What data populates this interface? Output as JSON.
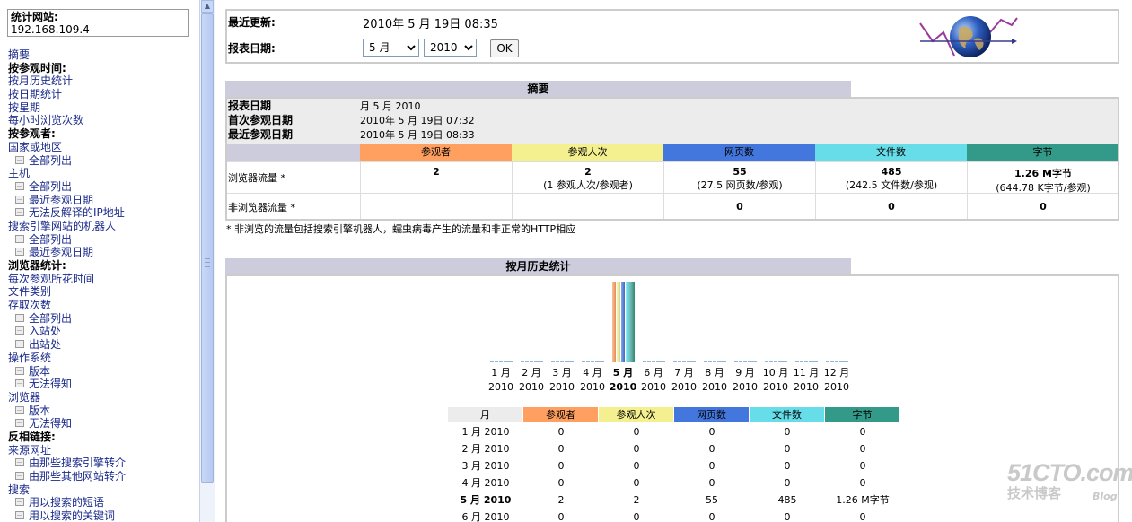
{
  "sidebar": {
    "site_label": "统计网站:",
    "site_value": "192.168.109.4",
    "items": [
      {
        "label": "摘要",
        "kind": "link"
      },
      {
        "label": "按参观时间:",
        "kind": "head"
      },
      {
        "label": "按月历史统计",
        "kind": "link"
      },
      {
        "label": "按日期统计",
        "kind": "link"
      },
      {
        "label": "按星期",
        "kind": "link"
      },
      {
        "label": "每小时浏览次数",
        "kind": "link"
      },
      {
        "label": "按参观者:",
        "kind": "head"
      },
      {
        "label": "国家或地区",
        "kind": "link"
      },
      {
        "label": "全部列出",
        "kind": "sub"
      },
      {
        "label": "主机",
        "kind": "link"
      },
      {
        "label": "全部列出",
        "kind": "sub"
      },
      {
        "label": "最近参观日期",
        "kind": "sub"
      },
      {
        "label": "无法反解译的IP地址",
        "kind": "sub"
      },
      {
        "label": "搜索引擎网站的机器人",
        "kind": "link"
      },
      {
        "label": "全部列出",
        "kind": "sub"
      },
      {
        "label": "最近参观日期",
        "kind": "sub"
      },
      {
        "label": "浏览器统计:",
        "kind": "head"
      },
      {
        "label": "每次参观所花时间",
        "kind": "link"
      },
      {
        "label": "文件类别",
        "kind": "link"
      },
      {
        "label": "存取次数",
        "kind": "link"
      },
      {
        "label": "全部列出",
        "kind": "sub"
      },
      {
        "label": "入站处",
        "kind": "sub"
      },
      {
        "label": "出站处",
        "kind": "sub"
      },
      {
        "label": "操作系统",
        "kind": "link"
      },
      {
        "label": "版本",
        "kind": "sub"
      },
      {
        "label": "无法得知",
        "kind": "sub"
      },
      {
        "label": "浏览器",
        "kind": "link"
      },
      {
        "label": "版本",
        "kind": "sub"
      },
      {
        "label": "无法得知",
        "kind": "sub"
      },
      {
        "label": "反相链接:",
        "kind": "head"
      },
      {
        "label": "来源网址",
        "kind": "link"
      },
      {
        "label": "由那些搜索引擎转介",
        "kind": "sub"
      },
      {
        "label": "由那些其他网站转介",
        "kind": "sub"
      },
      {
        "label": "搜索",
        "kind": "link"
      },
      {
        "label": "用以搜索的短语",
        "kind": "sub"
      },
      {
        "label": "用以搜索的关键词",
        "kind": "sub"
      }
    ]
  },
  "header": {
    "last_update_label": "最近更新:",
    "last_update_value": "2010年 5 月 19日 08:35",
    "report_date_label": "报表日期:",
    "month_selected": "5 月",
    "year_selected": "2010",
    "ok_label": "OK"
  },
  "summary": {
    "title": "摘要",
    "rows": [
      {
        "label": "报表日期",
        "value": "月 5 月 2010"
      },
      {
        "label": "首次参观日期",
        "value": "2010年 5 月 19日 07:32"
      },
      {
        "label": "最近参观日期",
        "value": "2010年 5 月 19日 08:33"
      }
    ],
    "columns": [
      "参观者",
      "参观人次",
      "网页数",
      "文件数",
      "字节"
    ],
    "browser_label": "浏览器流量 *",
    "browser_values": [
      "2",
      "2",
      "55",
      "485",
      "1.26 M字节"
    ],
    "browser_sub": [
      "",
      "(1 参观人次/参观者)",
      "(27.5 网页数/参观)",
      "(242.5 文件数/参观)",
      "(644.78 K字节/参观)"
    ],
    "nonbrowser_label": "非浏览器流量 *",
    "nonbrowser_values": [
      "",
      "",
      "0",
      "0",
      "0"
    ],
    "footnote": "* 非浏览的流量包括搜索引擎机器人，蠕虫病毒产生的流量和非正常的HTTP相应"
  },
  "history": {
    "title": "按月历史统计",
    "table_headers": [
      "月",
      "参观者",
      "参观人次",
      "网页数",
      "文件数",
      "字节"
    ]
  },
  "colors": {
    "visitors": "#ffa060",
    "visits": "#f4f090",
    "pages": "#4477dd",
    "files": "#66dde8",
    "bytes": "#339988",
    "section_title": "#ccccdd"
  },
  "chart_data": {
    "type": "bar",
    "categories": [
      "1 月 2010",
      "2 月 2010",
      "3 月 2010",
      "4 月 2010",
      "5 月 2010",
      "6 月 2010",
      "7 月 2010",
      "8 月 2010",
      "9 月 2010",
      "10 月 2010",
      "11 月 2010",
      "12 月 2010"
    ],
    "month_labels": [
      "1 月",
      "2 月",
      "3 月",
      "4 月",
      "5 月",
      "6 月",
      "7 月",
      "8 月",
      "9 月",
      "10 月",
      "11 月",
      "12 月"
    ],
    "year_label": "2010",
    "selected_index": 4,
    "series": [
      {
        "name": "参观者",
        "values": [
          0,
          0,
          0,
          0,
          2,
          0,
          0,
          0,
          0,
          0,
          0,
          0
        ]
      },
      {
        "name": "参观人次",
        "values": [
          0,
          0,
          0,
          0,
          2,
          0,
          0,
          0,
          0,
          0,
          0,
          0
        ]
      },
      {
        "name": "网页数",
        "values": [
          0,
          0,
          0,
          0,
          55,
          0,
          0,
          0,
          0,
          0,
          0,
          0
        ]
      },
      {
        "name": "文件数",
        "values": [
          0,
          0,
          0,
          0,
          485,
          0,
          0,
          0,
          0,
          0,
          0,
          0
        ]
      },
      {
        "name": "字节",
        "values": [
          0,
          0,
          0,
          0,
          "1.26 M字节",
          0,
          0,
          0,
          0,
          0,
          0,
          0
        ]
      }
    ],
    "rows": [
      {
        "month": "1 月 2010",
        "values": [
          "0",
          "0",
          "0",
          "0",
          "0"
        ]
      },
      {
        "month": "2 月 2010",
        "values": [
          "0",
          "0",
          "0",
          "0",
          "0"
        ]
      },
      {
        "month": "3 月 2010",
        "values": [
          "0",
          "0",
          "0",
          "0",
          "0"
        ]
      },
      {
        "month": "4 月 2010",
        "values": [
          "0",
          "0",
          "0",
          "0",
          "0"
        ]
      },
      {
        "month": "5 月 2010",
        "values": [
          "2",
          "2",
          "55",
          "485",
          "1.26 M字节"
        ]
      },
      {
        "month": "6 月 2010",
        "values": [
          "0",
          "0",
          "0",
          "0",
          "0"
        ]
      }
    ]
  },
  "watermark": {
    "line1": "51CTO.com",
    "line2": "技术博客",
    "line3": "Blog"
  }
}
